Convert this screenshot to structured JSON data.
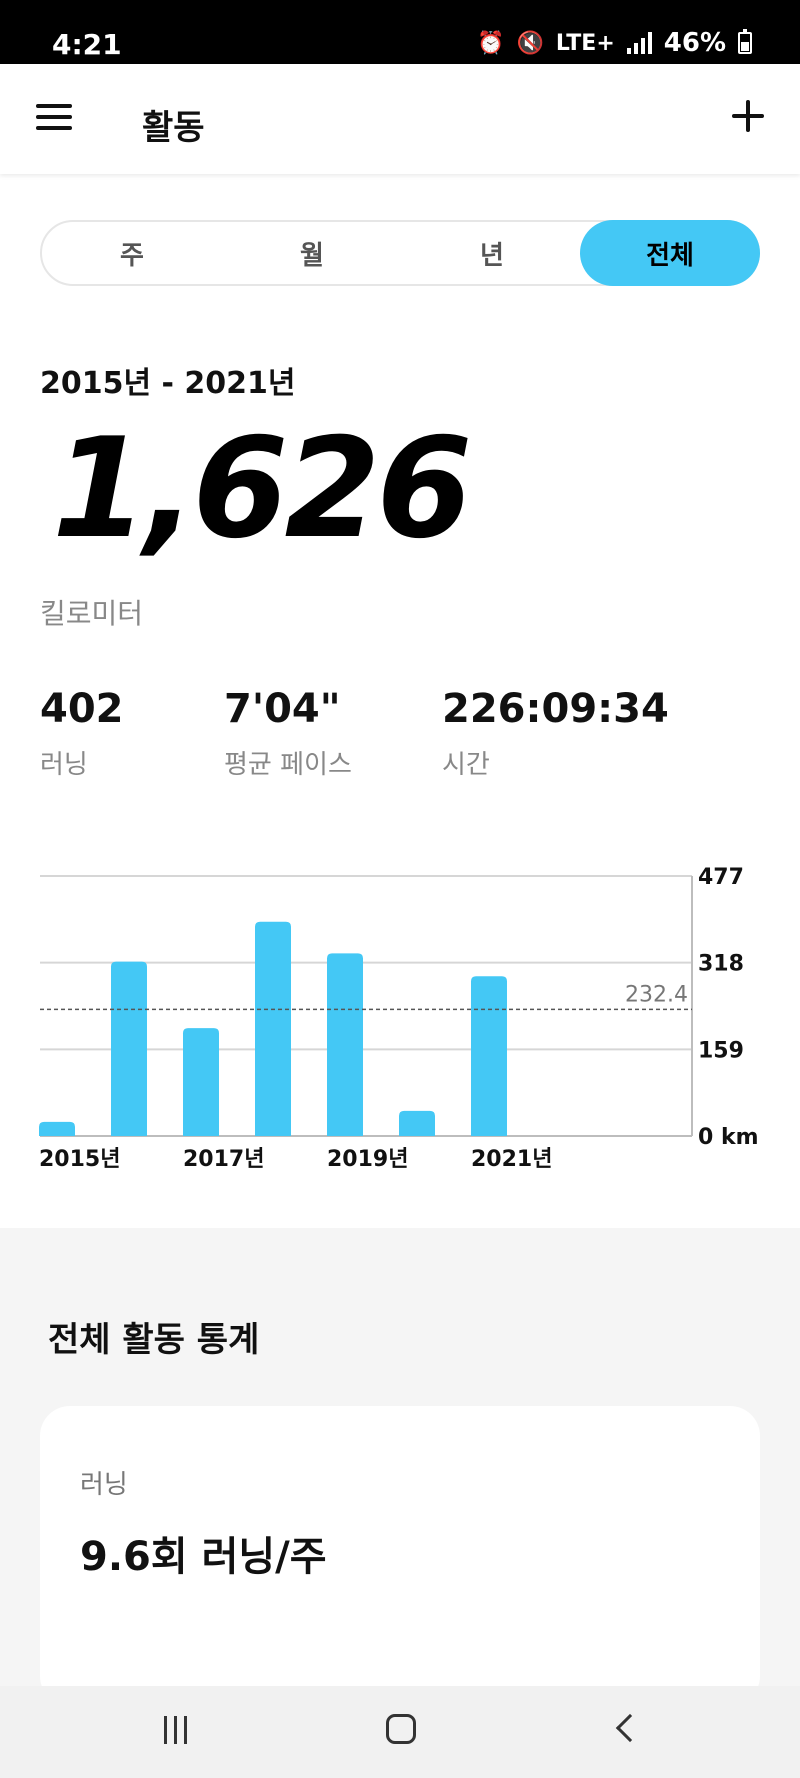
{
  "status_bar": {
    "time": "4:21",
    "network": "LTE+",
    "battery": "46%"
  },
  "app_bar": {
    "title": "활동"
  },
  "tabs": [
    {
      "label": "주",
      "active": false
    },
    {
      "label": "월",
      "active": false
    },
    {
      "label": "년",
      "active": false
    },
    {
      "label": "전체",
      "active": true
    }
  ],
  "summary": {
    "date_range": "2015년 - 2021년",
    "total_distance": "1,626",
    "distance_unit": "킬로미터",
    "stats": [
      {
        "value": "402",
        "label": "러닝"
      },
      {
        "value": "7'04\"",
        "label": "평균 페이스"
      },
      {
        "value": "226:09:34",
        "label": "시간"
      }
    ]
  },
  "chart_data": {
    "type": "bar",
    "x": [
      2015,
      2016,
      2017,
      2018,
      2019,
      2020,
      2021
    ],
    "x_tick_labels": [
      {
        "x": 2015,
        "label": "2015년"
      },
      {
        "x": 2017,
        "label": "2017년"
      },
      {
        "x": 2019,
        "label": "2019년"
      },
      {
        "x": 2021,
        "label": "2021년"
      }
    ],
    "values": [
      26,
      320,
      198,
      393,
      335,
      46,
      293
    ],
    "ylim": [
      0,
      477
    ],
    "y_ticks": [
      0,
      159,
      318,
      477
    ],
    "y_tick_labels": [
      "0 km",
      "159",
      "318",
      "477"
    ],
    "average": 232.4,
    "average_label": "232.4",
    "grid": true,
    "bar_color": "#44c8f5"
  },
  "stats_section": {
    "title": "전체 활동 통계",
    "card_label": "러닝",
    "card_value": "9.6회 러닝/주"
  },
  "colors": {
    "accent": "#44c8f5",
    "stats_background": "#f5f5f5"
  }
}
